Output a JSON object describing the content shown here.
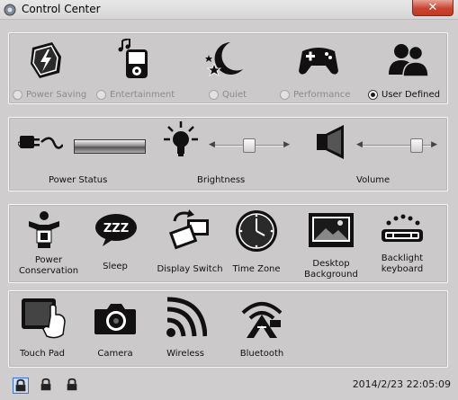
{
  "window": {
    "title": "Control Center",
    "close_label": "✕",
    "datetime": "2014/2/23 22:05:09"
  },
  "profiles": {
    "items": [
      {
        "label": "Power Saving",
        "icon": "power-saving-icon",
        "selected": false
      },
      {
        "label": "Entertainment",
        "icon": "entertainment-icon",
        "selected": false
      },
      {
        "label": "Quiet",
        "icon": "quiet-icon",
        "selected": false
      },
      {
        "label": "Performance",
        "icon": "performance-icon",
        "selected": false
      },
      {
        "label": "User Defined",
        "icon": "user-defined-icon",
        "selected": true
      }
    ]
  },
  "controls": {
    "power_status_label": "Power Status",
    "brightness_label": "Brightness",
    "volume_label": "Volume",
    "brightness_level": 0.5,
    "volume_level": 0.85
  },
  "tools": {
    "power_conservation_label_1": "Power",
    "power_conservation_label_2": "Conservation",
    "sleep_label": "Sleep",
    "sleep_icon_text": "ZZZ",
    "display_switch_label": "Display Switch",
    "time_zone_label": "Time Zone",
    "desktop_background_label_1": "Desktop",
    "desktop_background_label_2": "Background",
    "backlight_keyboard_label_1": "Backlight",
    "backlight_keyboard_label_2": "keyboard"
  },
  "devices": {
    "touch_pad_label": "Touch Pad",
    "camera_label": "Camera",
    "wireless_label": "Wireless",
    "bluetooth_label": "Bluetooth"
  }
}
